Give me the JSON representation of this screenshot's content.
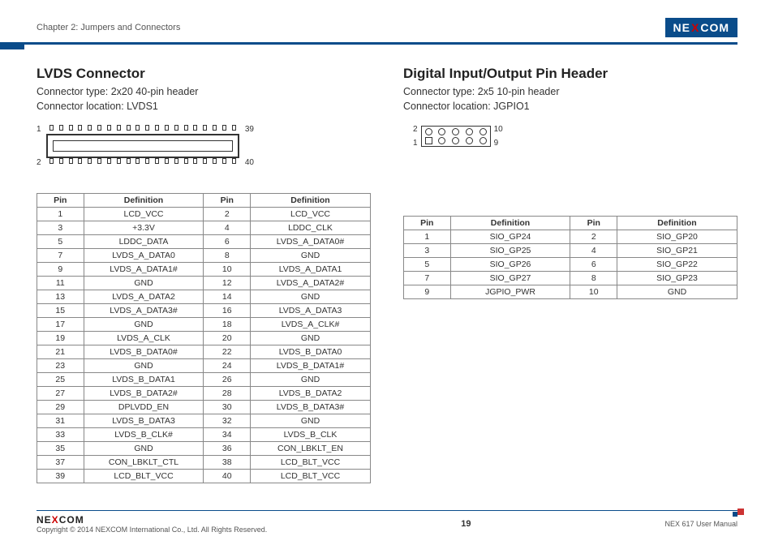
{
  "header": {
    "chapter": "Chapter 2: Jumpers and Connectors",
    "logo_left": "NE",
    "logo_x": "X",
    "logo_right": "COM"
  },
  "left": {
    "title": "LVDS Connector",
    "line1": "Connector type: 2x20 40-pin header",
    "line2": "Connector location: LVDS1",
    "pinlabels": {
      "tl": "1",
      "tr": "39",
      "bl": "2",
      "br": "40"
    },
    "cols": [
      "Pin",
      "Definition",
      "Pin",
      "Definition"
    ],
    "rows": [
      [
        "1",
        "LCD_VCC",
        "2",
        "LCD_VCC"
      ],
      [
        "3",
        "+3.3V",
        "4",
        "LDDC_CLK"
      ],
      [
        "5",
        "LDDC_DATA",
        "6",
        "LVDS_A_DATA0#"
      ],
      [
        "7",
        "LVDS_A_DATA0",
        "8",
        "GND"
      ],
      [
        "9",
        "LVDS_A_DATA1#",
        "10",
        "LVDS_A_DATA1"
      ],
      [
        "11",
        "GND",
        "12",
        "LVDS_A_DATA2#"
      ],
      [
        "13",
        "LVDS_A_DATA2",
        "14",
        "GND"
      ],
      [
        "15",
        "LVDS_A_DATA3#",
        "16",
        "LVDS_A_DATA3"
      ],
      [
        "17",
        "GND",
        "18",
        "LVDS_A_CLK#"
      ],
      [
        "19",
        "LVDS_A_CLK",
        "20",
        "GND"
      ],
      [
        "21",
        "LVDS_B_DATA0#",
        "22",
        "LVDS_B_DATA0"
      ],
      [
        "23",
        "GND",
        "24",
        "LVDS_B_DATA1#"
      ],
      [
        "25",
        "LVDS_B_DATA1",
        "26",
        "GND"
      ],
      [
        "27",
        "LVDS_B_DATA2#",
        "28",
        "LVDS_B_DATA2"
      ],
      [
        "29",
        "DPLVDD_EN",
        "30",
        "LVDS_B_DATA3#"
      ],
      [
        "31",
        "LVDS_B_DATA3",
        "32",
        "GND"
      ],
      [
        "33",
        "LVDS_B_CLK#",
        "34",
        "LVDS_B_CLK"
      ],
      [
        "35",
        "GND",
        "36",
        "CON_LBKLT_EN"
      ],
      [
        "37",
        "CON_LBKLT_CTL",
        "38",
        "LCD_BLT_VCC"
      ],
      [
        "39",
        "LCD_BLT_VCC",
        "40",
        "LCD_BLT_VCC"
      ]
    ]
  },
  "right": {
    "title": "Digital Input/Output Pin Header",
    "line1": "Connector type: 2x5 10-pin header",
    "line2": "Connector location: JGPIO1",
    "pinlabels": {
      "lt": "2",
      "lb": "1",
      "rt": "10",
      "rb": "9"
    },
    "cols": [
      "Pin",
      "Definition",
      "Pin",
      "Definition"
    ],
    "rows": [
      [
        "1",
        "SIO_GP24",
        "2",
        "SIO_GP20"
      ],
      [
        "3",
        "SIO_GP25",
        "4",
        "SIO_GP21"
      ],
      [
        "5",
        "SIO_GP26",
        "6",
        "SIO_GP22"
      ],
      [
        "7",
        "SIO_GP27",
        "8",
        "SIO_GP23"
      ],
      [
        "9",
        "JGPIO_PWR",
        "10",
        "GND"
      ]
    ]
  },
  "footer": {
    "logo_left": "NE",
    "logo_x": "X",
    "logo_right": "COM",
    "copyright": "Copyright © 2014 NEXCOM International Co., Ltd. All Rights Reserved.",
    "page": "19",
    "manual": "NEX 617 User Manual"
  }
}
